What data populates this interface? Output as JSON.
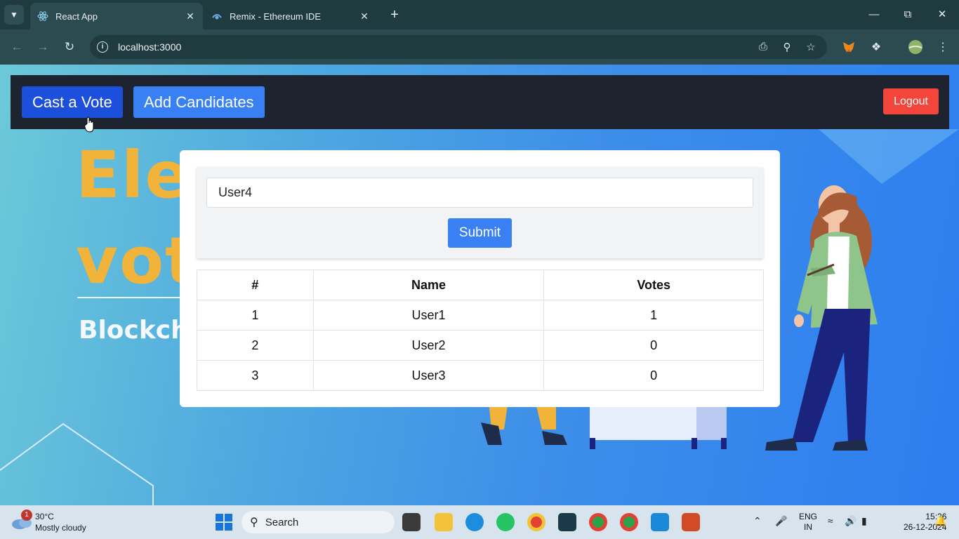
{
  "browser": {
    "tabs": [
      {
        "label": "React App",
        "active": true
      },
      {
        "label": "Remix - Ethereum IDE",
        "active": false
      }
    ],
    "url": "localhost:3000"
  },
  "navbar": {
    "cast_vote": "Cast a Vote",
    "add_candidates": "Add Candidates",
    "logout": "Logout"
  },
  "background": {
    "line1": "Ele",
    "line2": "vot",
    "line3": "Blockch"
  },
  "form": {
    "candidate_value": "User4",
    "submit_label": "Submit"
  },
  "table": {
    "headers": [
      "#",
      "Name",
      "Votes"
    ],
    "rows": [
      {
        "index": "1",
        "name": "User1",
        "votes": "1"
      },
      {
        "index": "2",
        "name": "User2",
        "votes": "0"
      },
      {
        "index": "3",
        "name": "User3",
        "votes": "0"
      }
    ]
  },
  "taskbar": {
    "weather_badge": "1",
    "temperature": "30°C",
    "condition": "Mostly cloudy",
    "search_label": "Search",
    "lang_line1": "ENG",
    "lang_line2": "IN",
    "time": "15:26",
    "date": "26-12-2024"
  },
  "colors": {
    "navbar_bg": "#1e2330",
    "primary_button": "#3a80f5",
    "active_button": "#1c4fdc",
    "logout_button": "#f4453a",
    "headline_orange": "#f2b33a"
  }
}
